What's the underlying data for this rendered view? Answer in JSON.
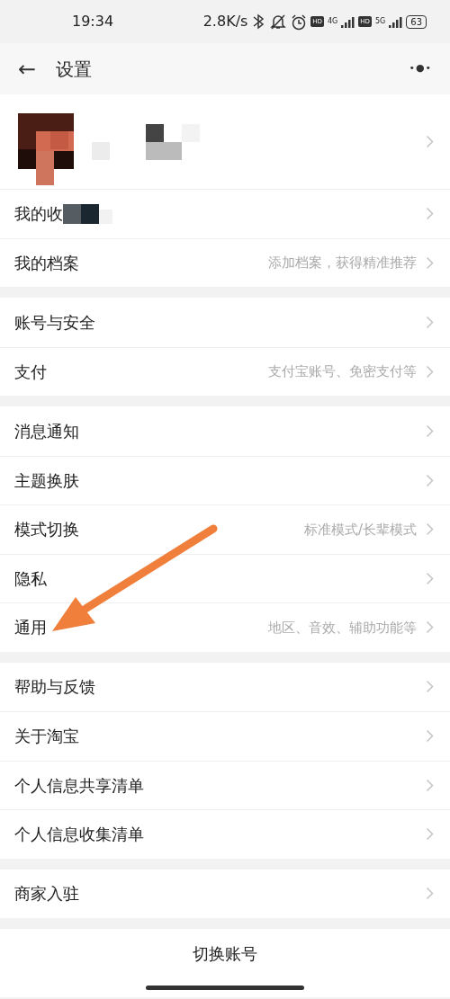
{
  "status_bar": {
    "time": "19:34",
    "speed": "2.8K/s",
    "sim1_badge": "HD",
    "sim1_network": "4G",
    "sim2_badge": "HD",
    "sim2_network": "5G",
    "battery": "63"
  },
  "header": {
    "back": "←",
    "title": "设置",
    "more": "•●•"
  },
  "profile": {
    "kind": "profile"
  },
  "groups": [
    {
      "items": [
        {
          "label": "我的收",
          "redacted": true
        },
        {
          "label": "我的档案",
          "value": "添加档案，获得精准推荐"
        }
      ]
    },
    {
      "items": [
        {
          "label": "账号与安全"
        },
        {
          "label": "支付",
          "value": "支付宝账号、免密支付等"
        }
      ]
    },
    {
      "items": [
        {
          "label": "消息通知"
        },
        {
          "label": "主题换肤"
        },
        {
          "label": "模式切换",
          "value": "标准模式/长辈模式"
        },
        {
          "label": "隐私"
        },
        {
          "label": "通用",
          "value": "地区、音效、辅助功能等"
        }
      ]
    },
    {
      "items": [
        {
          "label": "帮助与反馈"
        },
        {
          "label": "关于淘宝"
        },
        {
          "label": "个人信息共享清单"
        },
        {
          "label": "个人信息收集清单"
        }
      ]
    },
    {
      "items": [
        {
          "label": "商家入驻"
        }
      ]
    }
  ],
  "switch_account": "切换账号"
}
